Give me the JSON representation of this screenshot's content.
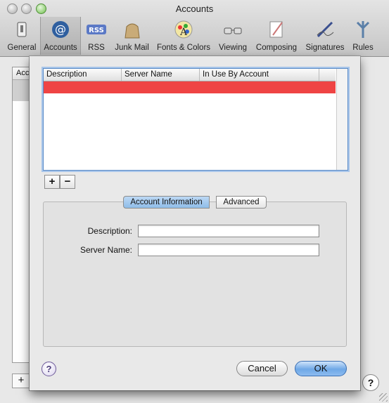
{
  "window": {
    "title": "Accounts"
  },
  "toolbar": {
    "items": [
      {
        "label": "General",
        "icon": "switch-icon"
      },
      {
        "label": "Accounts",
        "icon": "at-sign-icon"
      },
      {
        "label": "RSS",
        "icon": "rss-icon"
      },
      {
        "label": "Junk Mail",
        "icon": "junk-bag-icon"
      },
      {
        "label": "Fonts & Colors",
        "icon": "palette-icon"
      },
      {
        "label": "Viewing",
        "icon": "glasses-icon"
      },
      {
        "label": "Composing",
        "icon": "pencil-paper-icon"
      },
      {
        "label": "Signatures",
        "icon": "pen-icon"
      },
      {
        "label": "Rules",
        "icon": "rules-icon"
      }
    ],
    "selected": "Accounts"
  },
  "background": {
    "list_header": "Acc",
    "add_symbol": "+",
    "help_symbol": "?"
  },
  "sheet": {
    "table": {
      "columns": [
        "Description",
        "Server Name",
        "In Use By Account"
      ],
      "rows": [
        {
          "description": "",
          "server_name": "",
          "in_use_by": ""
        }
      ],
      "selected_row_color": "#ef4444"
    },
    "add_symbol": "+",
    "remove_symbol": "−",
    "tabs": [
      "Account Information",
      "Advanced"
    ],
    "active_tab": "Account Information",
    "form": {
      "description_label": "Description:",
      "description_value": "",
      "server_name_label": "Server Name:",
      "server_name_value": ""
    },
    "help_symbol": "?",
    "cancel_label": "Cancel",
    "ok_label": "OK"
  }
}
